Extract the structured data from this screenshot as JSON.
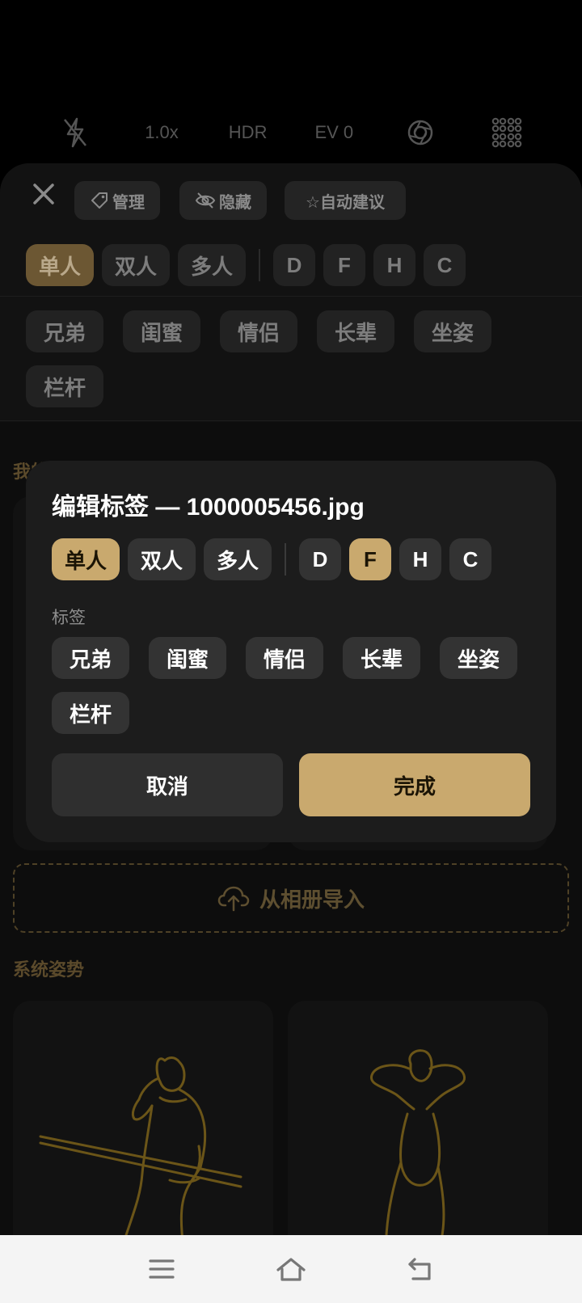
{
  "camera": {
    "flash_icon": "flash-off-icon",
    "zoom": "1.0x",
    "hdr": "HDR",
    "ev": "EV 0",
    "shutter_icon": "aperture-icon",
    "grid_icon": "grid-icon"
  },
  "sheet": {
    "toolbar": {
      "manage": "管理",
      "hide": "隐藏",
      "auto_suggest": "☆自动建议"
    },
    "people_filters": [
      "单人",
      "双人",
      "多人"
    ],
    "letter_filters": [
      "D",
      "F",
      "H",
      "C"
    ],
    "tags": [
      "兄弟",
      "闺蜜",
      "情侣",
      "长辈",
      "坐姿",
      "栏杆"
    ],
    "my_section_partial": "我的",
    "import_label": "从相册导入",
    "system_section": "系统姿势"
  },
  "dialog": {
    "title": "编辑标签 — 1000005456.jpg",
    "people_options": [
      "单人",
      "双人",
      "多人"
    ],
    "letter_options": [
      "D",
      "F",
      "H",
      "C"
    ],
    "tags_label": "标签",
    "tags": [
      "兄弟",
      "闺蜜",
      "情侣",
      "长辈",
      "坐姿",
      "栏杆"
    ],
    "cancel": "取消",
    "done": "完成"
  },
  "colors": {
    "accent": "#c9a96e",
    "accent_dim": "#6c5733",
    "outline_gold": "#6b5518"
  },
  "navbar": {
    "icons": [
      "menu-icon",
      "home-icon",
      "back-icon"
    ]
  }
}
